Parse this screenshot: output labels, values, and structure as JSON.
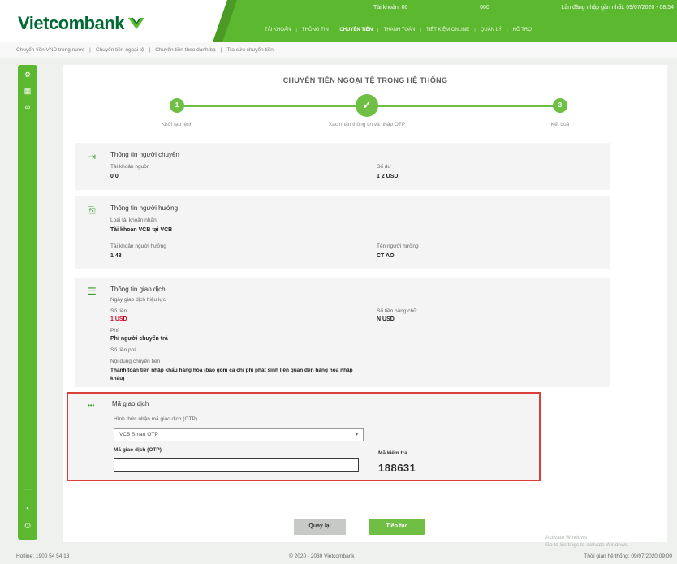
{
  "brand": {
    "name": "Vietcombank",
    "accent": "#5cb82f",
    "dark_green": "#006a35"
  },
  "header": {
    "top_left": "Tài khoản: 00",
    "top_mid": "000",
    "top_right": "Lần đăng nhập gần nhất: 09/07/2020 - 08:54",
    "nav": [
      "TÀI KHOẢN",
      "THÔNG TIN",
      "CHUYỂN TIỀN",
      "THANH TOÁN",
      "TIẾT KIỆM ONLINE",
      "QUẢN LÝ",
      "HỖ TRỢ"
    ]
  },
  "subnav": [
    "Chuyển tiền VND trong nước",
    "Chuyển tiền ngoại tệ",
    "Chuyển tiền theo danh bạ",
    "Tra cứu chuyển tiền"
  ],
  "page": {
    "title": "CHUYỂN TIỀN NGOẠI TỆ TRONG HỆ THỐNG"
  },
  "stepper": [
    {
      "num": "1",
      "label": "Khởi tạo lệnh"
    },
    {
      "num": "✓",
      "label": "Xác nhận thông tin và nhập OTP"
    },
    {
      "num": "3",
      "label": "Kết quả"
    }
  ],
  "sender": {
    "title": "Thông tin người chuyển",
    "account_label": "Tài khoản nguồn",
    "account_value": "0          0",
    "balance_label": "Số dư",
    "balance_value": "1      2 USD"
  },
  "receiver": {
    "title": "Thông tin người hưởng",
    "type_label": "Loại tài khoản nhận",
    "type_value": "Tài khoản VCB tại VCB",
    "account_label": "Tài khoản người hưởng",
    "account_value": "1        48",
    "name_label": "Tên người hưởng",
    "name_value": "CT                               AO"
  },
  "transaction": {
    "title": "Thông tin giao dịch",
    "date_label": "Ngày giao dịch hiệu lực",
    "amount_label": "Số tiền",
    "amount_value": "1 USD",
    "amount_words_label": "Số tiền bằng chữ",
    "amount_words_value": "N  USD",
    "fee_label": "Phí",
    "fee_value": "Phí người chuyển trả",
    "fee_amount_label": "Số tiền phí",
    "content_label": "Nội dung chuyển tiền",
    "content_value": "Thanh toán tiền nhập khẩu hàng hóa (bao gồm cả chi phí phát sinh liên quan đến hàng hóa nhập khẩu)"
  },
  "otp": {
    "title": "Mã giao dịch",
    "method_label": "Hình thức nhận mã giao dịch (OTP)",
    "method_value": "VCB Smart OTP",
    "code_label": "Mã giao dịch (OTP)",
    "code_input_value": "",
    "challenge_label": "Mã kiểm tra",
    "challenge_value": "188631"
  },
  "buttons": {
    "back": "Quay lại",
    "next": "Tiếp tục"
  },
  "footer": {
    "left": "Hotline: 1900 54 54 13",
    "center": "© 2020 - 2030 Vietcombank",
    "right": "Thời gian hệ thống: 09/07/2020 09:00"
  },
  "watermark": {
    "line1": "Activate Windows",
    "line2": "Go to Settings to activate Windows."
  }
}
